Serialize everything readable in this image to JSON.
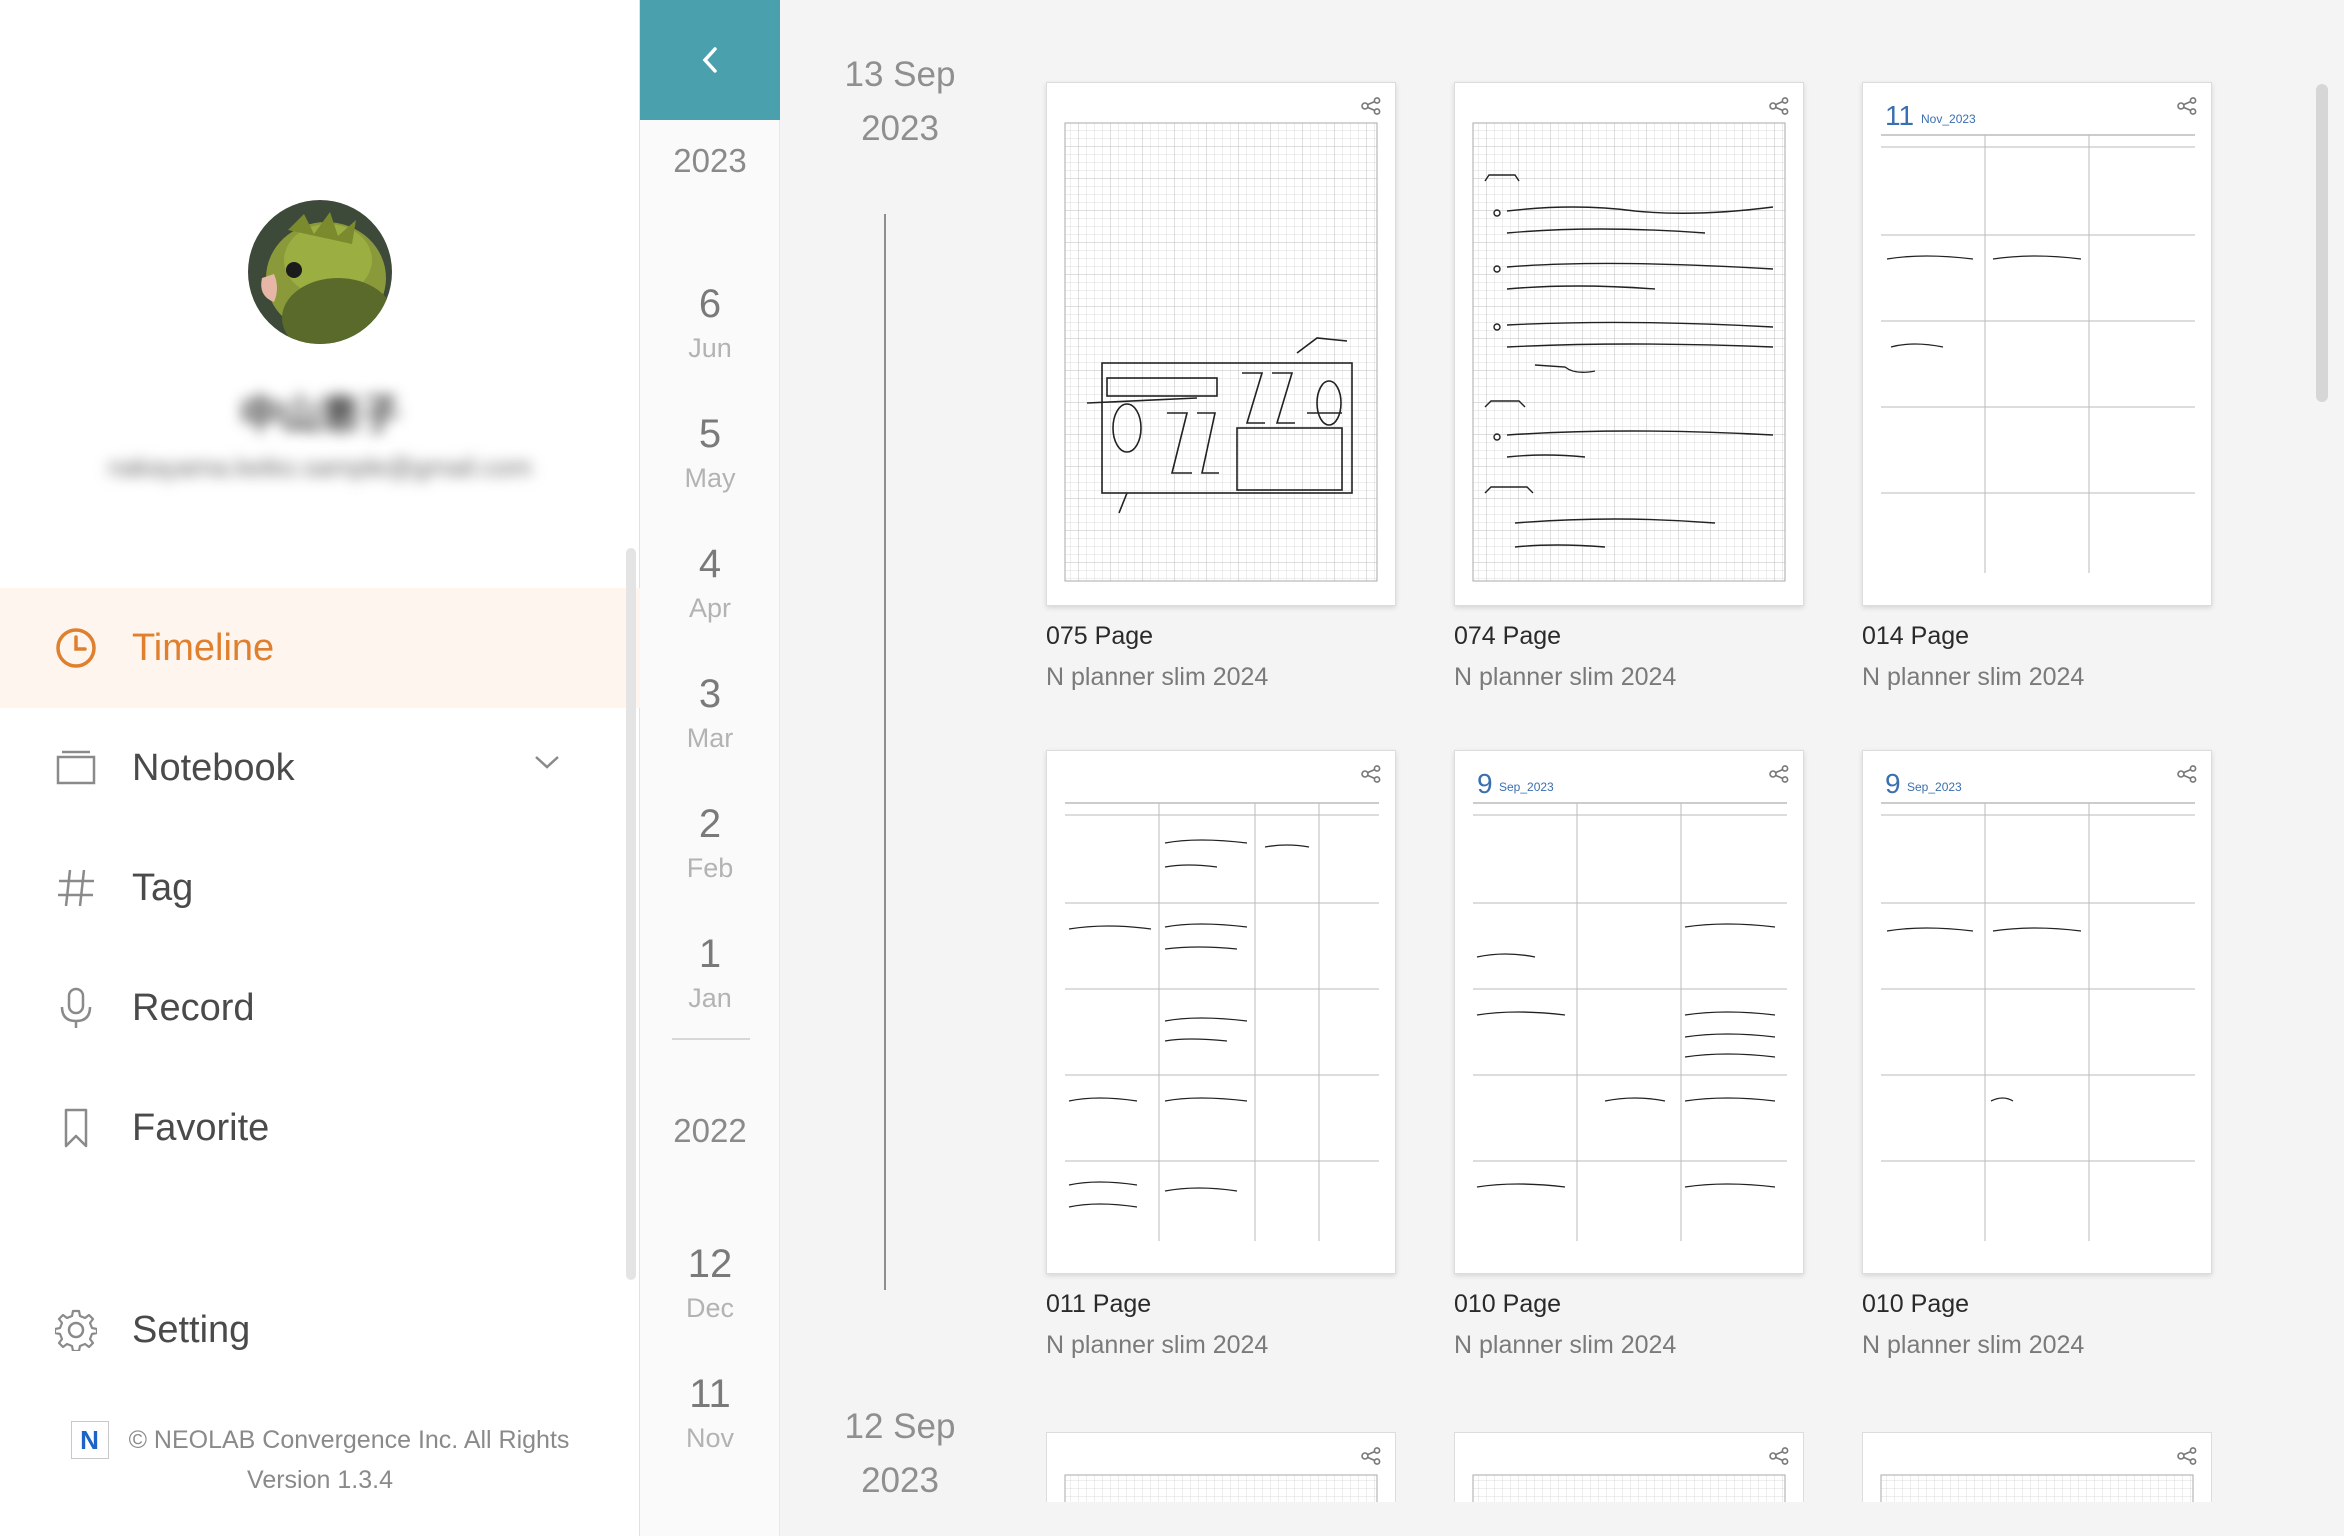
{
  "sidebar": {
    "user_name": "中山恵子",
    "user_email": "nakayama.keiko.sample@gmail.com",
    "nav": [
      {
        "label": "Timeline",
        "icon": "clock-icon",
        "active": true
      },
      {
        "label": "Notebook",
        "icon": "notebook-icon",
        "active": false
      },
      {
        "label": "Tag",
        "icon": "hash-icon",
        "active": false
      },
      {
        "label": "Record",
        "icon": "microphone-icon",
        "active": false
      },
      {
        "label": "Favorite",
        "icon": "bookmark-icon",
        "active": false
      }
    ],
    "setting_label": "Setting",
    "copyright": "© NEOLAB Convergence Inc. All Rights",
    "version": "Version 1.3.4",
    "logo_letter": "N"
  },
  "rail": {
    "years": [
      "2023",
      "2022"
    ],
    "months": [
      {
        "num": "6",
        "mon": "Jun"
      },
      {
        "num": "5",
        "mon": "May"
      },
      {
        "num": "4",
        "mon": "Apr"
      },
      {
        "num": "3",
        "mon": "Mar"
      },
      {
        "num": "2",
        "mon": "Feb"
      },
      {
        "num": "1",
        "mon": "Jan"
      },
      {
        "num": "12",
        "mon": "Dec"
      },
      {
        "num": "11",
        "mon": "Nov"
      }
    ]
  },
  "groups": [
    {
      "day": "13 Sep",
      "year": "2023"
    },
    {
      "day": "12 Sep",
      "year": "2023"
    }
  ],
  "cards": [
    {
      "title": "075 Page",
      "notebook": "N planner slim 2024",
      "thumb": "grid-sketch"
    },
    {
      "title": "074 Page",
      "notebook": "N planner slim 2024",
      "thumb": "grid-notes"
    },
    {
      "title": "014 Page",
      "notebook": "N planner slim 2024",
      "thumb": "calendar",
      "cal_day": "11",
      "cal_month": "Nov_2023"
    },
    {
      "title": "011 Page",
      "notebook": "N planner slim 2024",
      "thumb": "calendar-week"
    },
    {
      "title": "010 Page",
      "notebook": "N planner slim 2024",
      "thumb": "calendar",
      "cal_day": "9",
      "cal_month": "Sep_2023"
    },
    {
      "title": "010 Page",
      "notebook": "N planner slim 2024",
      "thumb": "calendar",
      "cal_day": "9",
      "cal_month": "Sep_2023"
    }
  ],
  "colors": {
    "accent": "#e0802e",
    "teal": "#4aa0ac",
    "calendar_blue": "#3a6fb0"
  }
}
